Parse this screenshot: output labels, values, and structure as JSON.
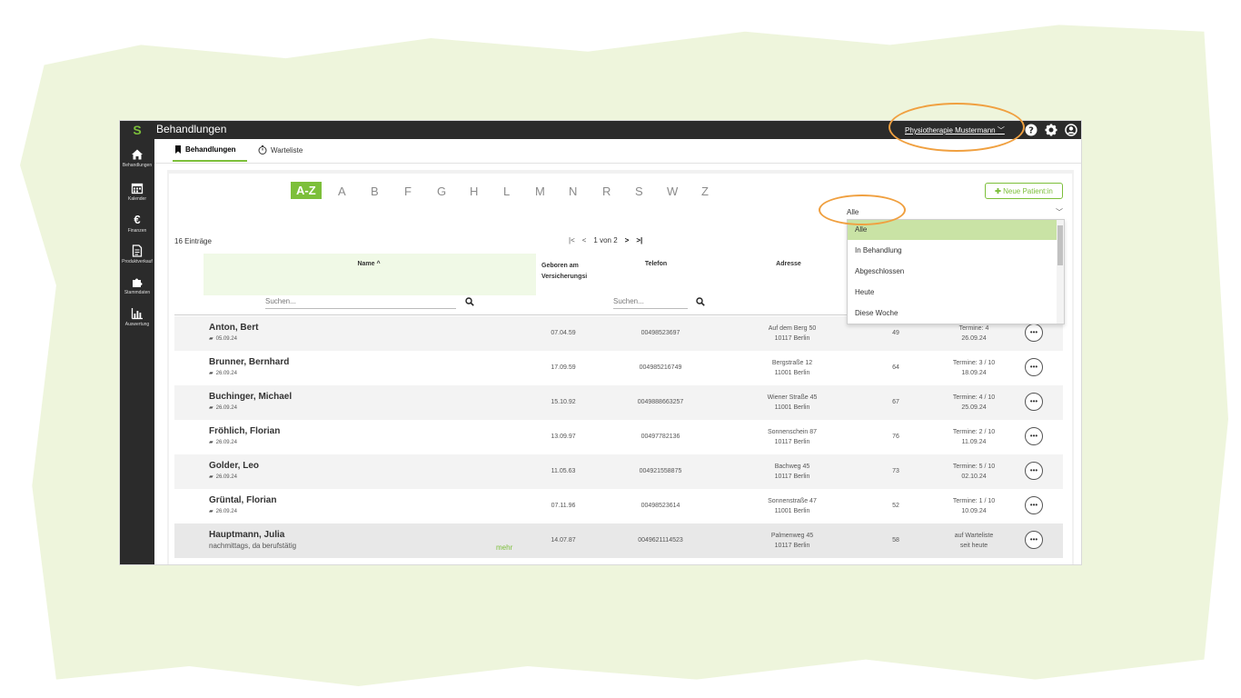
{
  "app": {
    "title": "Behandlungen",
    "logo": "S"
  },
  "org": {
    "name": "Physiotherapie Mustermann"
  },
  "sidebar": {
    "items": [
      {
        "label": "Behandlungen",
        "icon": "home-icon"
      },
      {
        "label": "Kalender",
        "icon": "calendar-icon"
      },
      {
        "label": "Finanzen",
        "icon": "euro-icon"
      },
      {
        "label": "Produktverkauf",
        "icon": "document-icon"
      },
      {
        "label": "Stammdaten",
        "icon": "puzzle-icon"
      },
      {
        "label": "Auswertung",
        "icon": "chart-icon"
      }
    ]
  },
  "tabs": [
    {
      "label": "Behandlungen",
      "active": true
    },
    {
      "label": "Warteliste",
      "active": false
    }
  ],
  "alphabet": [
    "A-Z",
    "A",
    "B",
    "F",
    "G",
    "H",
    "L",
    "M",
    "N",
    "R",
    "S",
    "W",
    "Z"
  ],
  "new_patient_label": "Neue Patient:in",
  "filter": {
    "value": "Alle",
    "options": [
      "Alle",
      "In Behandlung",
      "Abgeschlossen",
      "Heute",
      "Diese Woche"
    ]
  },
  "entries_count": "16 Einträge",
  "pager": {
    "text": "1 von 2"
  },
  "columns": {
    "name": "Name",
    "born_line1": "Geboren am",
    "born_line2": "Versicherungsi",
    "phone": "Telefon",
    "address": "Adresse"
  },
  "search_placeholder": "Suchen...",
  "rows": [
    {
      "name": "Anton, Bert",
      "sub": "05.09.24",
      "born": "07.04.59",
      "phone": "00498523697",
      "addr1": "Auf dem Berg 50",
      "addr2": "10117 Berlin",
      "num": "49",
      "t1": "Termine: 4",
      "t2": "26.09.24"
    },
    {
      "name": "Brunner, Bernhard",
      "sub": "26.09.24",
      "born": "17.09.59",
      "phone": "004985216749",
      "addr1": "Bergstraße 12",
      "addr2": "11001 Berlin",
      "num": "64",
      "t1": "Termine: 3 / 10",
      "t2": "18.09.24"
    },
    {
      "name": "Buchinger, Michael",
      "sub": "26.09.24",
      "born": "15.10.92",
      "phone": "0049888663257",
      "addr1": "Wiener Straße 45",
      "addr2": "11001 Berlin",
      "num": "67",
      "t1": "Termine: 4 / 10",
      "t2": "25.09.24"
    },
    {
      "name": "Fröhlich, Florian",
      "sub": "26.09.24",
      "born": "13.09.97",
      "phone": "00497782136",
      "addr1": "Sonnenschein 87",
      "addr2": "10117 Berlin",
      "num": "76",
      "t1": "Termine: 2 / 10",
      "t2": "11.09.24"
    },
    {
      "name": "Golder, Leo",
      "sub": "26.09.24",
      "born": "11.05.63",
      "phone": "004921558875",
      "addr1": "Bachweg 45",
      "addr2": "10117 Berlin",
      "num": "73",
      "t1": "Termine: 5 / 10",
      "t2": "02.10.24"
    },
    {
      "name": "Grüntal, Florian",
      "sub": "26.09.24",
      "born": "07.11.96",
      "phone": "00498523614",
      "addr1": "Sonnenstraße 47",
      "addr2": "11001 Berlin",
      "num": "52",
      "t1": "Termine: 1 / 10",
      "t2": "10.09.24"
    },
    {
      "name": "Hauptmann, Julia",
      "sub": "nachmittags, da berufstätig",
      "mehr": "mehr",
      "born": "14.07.87",
      "phone": "0049621114523",
      "addr1": "Palmenweg 45",
      "addr2": "10117 Berlin",
      "num": "58",
      "t1": "auf Warteliste",
      "t2": "seit heute"
    }
  ],
  "colors": {
    "accent": "#7cbf3a",
    "dark": "#2b2b2b",
    "highlight_ring": "#f0a040"
  }
}
